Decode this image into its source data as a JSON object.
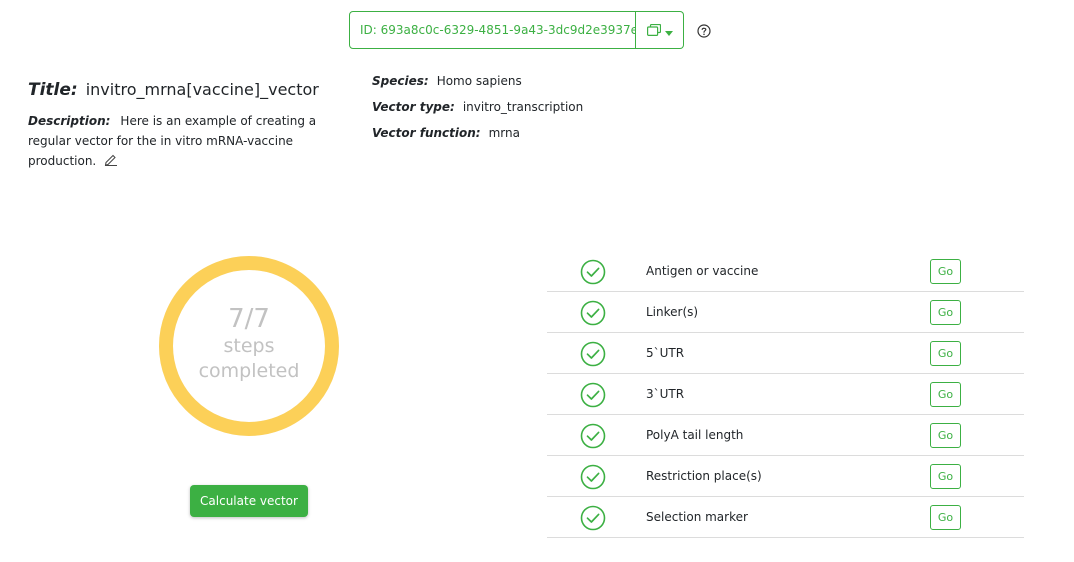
{
  "header": {
    "id_text": "ID: 693a8c0c-6329-4851-9a43-3dc9d2e3937e"
  },
  "meta": {
    "title_label": "Title:",
    "title_value": "invitro_mrna[vaccine]_vector",
    "description_label": "Description:",
    "description_value": "Here is an example of creating a regular vector for the in vitro mRNA-vaccine production.",
    "species_label": "Species:",
    "species_value": "Homo sapiens",
    "vector_type_label": "Vector type:",
    "vector_type_value": "invitro_transcription",
    "vector_function_label": "Vector function:",
    "vector_function_value": "mrna"
  },
  "progress": {
    "count": "7/7",
    "label_line1": "steps",
    "label_line2": "completed",
    "completed": 7,
    "total": 7,
    "color": "#fcd058"
  },
  "calculate_button": "Calculate vector",
  "steps": [
    {
      "label": "Antigen or vaccine",
      "go": "Go"
    },
    {
      "label": "Linker(s)",
      "go": "Go"
    },
    {
      "label": "5`UTR",
      "go": "Go"
    },
    {
      "label": "3`UTR",
      "go": "Go"
    },
    {
      "label": "PolyA tail length",
      "go": "Go"
    },
    {
      "label": "Restriction place(s)",
      "go": "Go"
    },
    {
      "label": "Selection marker",
      "go": "Go"
    }
  ],
  "colors": {
    "accent": "#3cb043",
    "ring": "#fcd058",
    "muted_text": "#c2c2c2"
  }
}
